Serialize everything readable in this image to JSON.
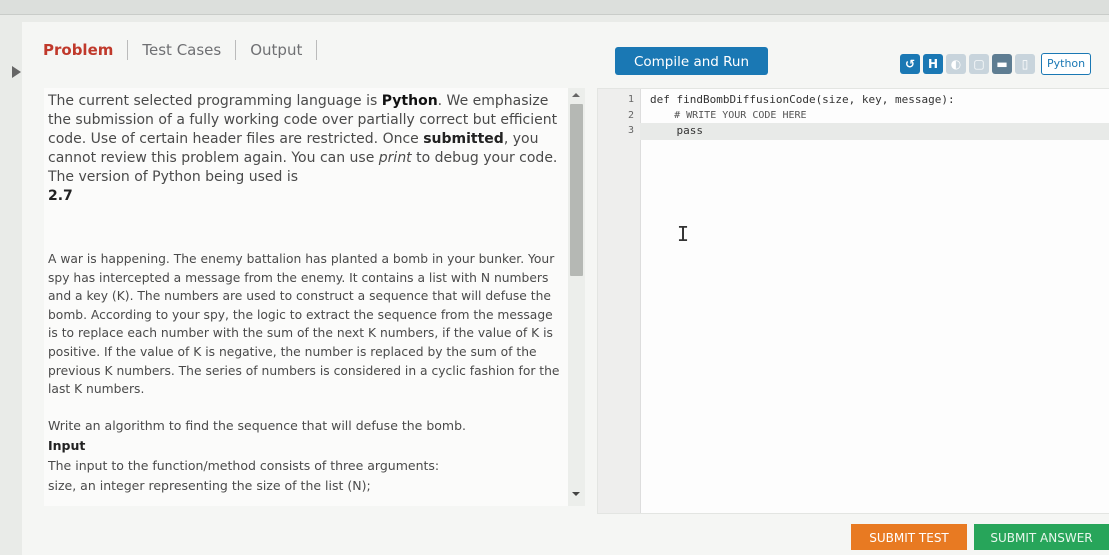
{
  "tabs": [
    {
      "label": "Problem"
    },
    {
      "label": "Test Cases"
    },
    {
      "label": "Output"
    }
  ],
  "toolbar": {
    "compile_label": "Compile and Run",
    "language": "Python",
    "icons": [
      "reset-icon",
      "save-icon",
      "theme-icon",
      "layout-split-icon",
      "layout-full-icon",
      "layout-side-icon"
    ]
  },
  "problem": {
    "intro_1": "The current selected programming language is ",
    "intro_lang": "Python",
    "intro_2": ". We emphasize the submission of a fully working code over partially correct but efficient code. Use of certain header files are restricted. Once ",
    "intro_submitted": "submitted",
    "intro_3": ", you cannot review this problem again. You can use ",
    "intro_print": "print",
    "intro_4": " to debug your code. The version of Python being used is ",
    "intro_version": "2.7",
    "statement": "A war is happening. The enemy battalion has planted a bomb in your bunker. Your spy has intercepted a message from the enemy. It contains a list with N numbers and a key (K). The numbers are used to construct a sequence that will defuse the bomb. According to your spy, the logic to extract the sequence from the message is to replace each number with the sum of the next K numbers, if the value of K is positive. If the value of K is negative, the number is replaced by the sum of the previous K numbers. The series of numbers is considered in a cyclic fashion for the last K numbers.",
    "task": "Write an algorithm to find the sequence that will defuse the bomb.",
    "input_heading": "Input",
    "input_text": "The input to the function/method consists of three arguments:",
    "cut_line": "size, an integer representing the size of the list (N);"
  },
  "editor": {
    "lines": [
      {
        "num": "1",
        "code": "def findBombDiffusionCode(size, key, message):"
      },
      {
        "num": "2",
        "code": "    # WRITE YOUR CODE HERE"
      },
      {
        "num": "3",
        "code": "    pass"
      }
    ]
  },
  "actions": {
    "submit_test": "SUBMIT TEST",
    "submit_answer": "SUBMIT ANSWER"
  },
  "colors": {
    "accent": "#1a78b4",
    "active_tab": "#c0392b",
    "submit_test": "#e87a22",
    "submit_answer": "#27a55a"
  }
}
